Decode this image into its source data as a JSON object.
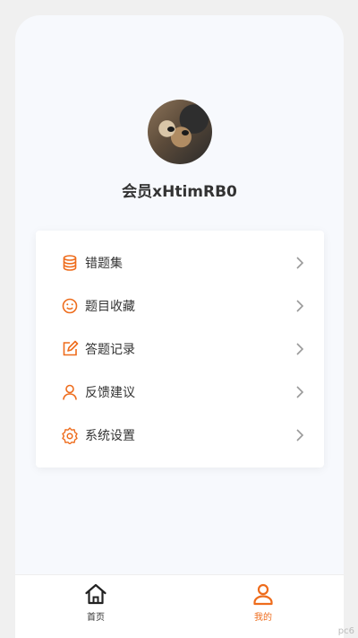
{
  "profile": {
    "username": "会员xHtimRB0"
  },
  "menu": [
    {
      "label": "错题集",
      "icon": "database-icon"
    },
    {
      "label": "题目收藏",
      "icon": "smiley-icon"
    },
    {
      "label": "答题记录",
      "icon": "edit-icon"
    },
    {
      "label": "反馈建议",
      "icon": "user-icon"
    },
    {
      "label": "系统设置",
      "icon": "gear-icon"
    }
  ],
  "tabbar": {
    "home_label": "首页",
    "mine_label": "我的"
  },
  "colors": {
    "accent": "#ee6c1c",
    "text": "#333333",
    "chevron": "#999999"
  },
  "watermark": "pc6"
}
